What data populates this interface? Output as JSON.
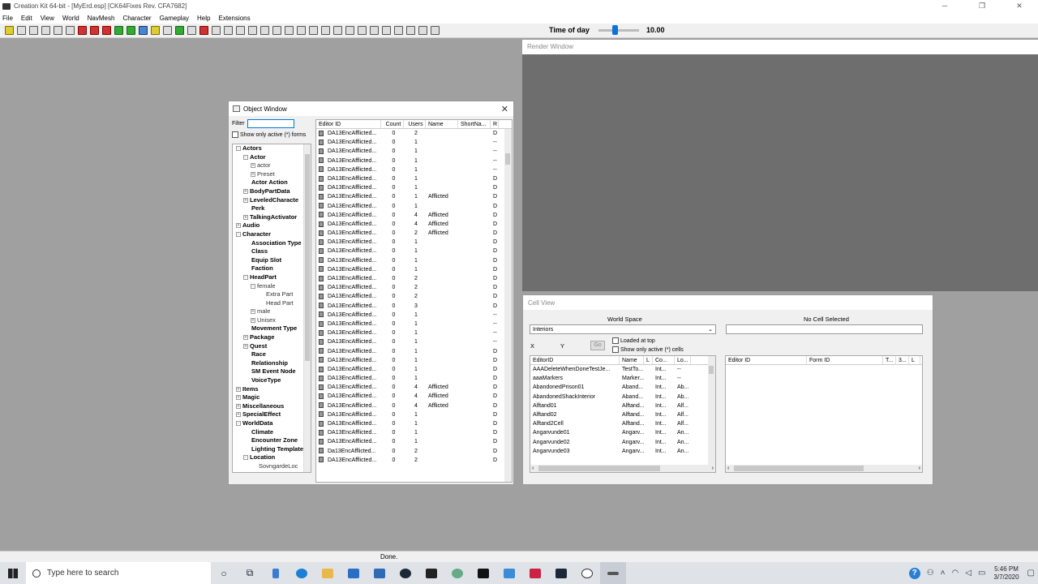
{
  "window": {
    "title": "Creation Kit 64-bit - [MyErd.esp] [CK64Fixes Rev. CFA7682]"
  },
  "menu": [
    "File",
    "Edit",
    "View",
    "World",
    "NavMesh",
    "Character",
    "Gameplay",
    "Help",
    "Extensions"
  ],
  "toolbar": {
    "time_label": "Time of day",
    "time_value": "10.00",
    "time_fraction": 0.4
  },
  "render_window": {
    "title": "Render Window"
  },
  "object_window": {
    "title": "Object Window",
    "filter_label": "Filter",
    "filter_value": "",
    "show_active_label": "Show only active (*) forms",
    "tree": [
      {
        "label": "Actors",
        "level": 0,
        "exp": "-"
      },
      {
        "label": "Actor",
        "level": 1,
        "exp": "-"
      },
      {
        "label": "actor",
        "level": 2,
        "exp": "+",
        "light": true
      },
      {
        "label": "Preset",
        "level": 2,
        "exp": "+",
        "light": true
      },
      {
        "label": "Actor Action",
        "level": 1,
        "exp": ""
      },
      {
        "label": "BodyPartData",
        "level": 1,
        "exp": "+"
      },
      {
        "label": "LeveledCharacte",
        "level": 1,
        "exp": "+"
      },
      {
        "label": "Perk",
        "level": 1,
        "exp": ""
      },
      {
        "label": "TalkingActivator",
        "level": 1,
        "exp": "+"
      },
      {
        "label": "Audio",
        "level": 0,
        "exp": "+"
      },
      {
        "label": "Character",
        "level": 0,
        "exp": "-"
      },
      {
        "label": "Association Type",
        "level": 1,
        "exp": ""
      },
      {
        "label": "Class",
        "level": 1,
        "exp": ""
      },
      {
        "label": "Equip Slot",
        "level": 1,
        "exp": ""
      },
      {
        "label": "Faction",
        "level": 1,
        "exp": ""
      },
      {
        "label": "HeadPart",
        "level": 1,
        "exp": "-"
      },
      {
        "label": "female",
        "level": 2,
        "exp": "-",
        "light": true
      },
      {
        "label": "Extra Part",
        "level": 3,
        "exp": "",
        "light": true
      },
      {
        "label": "Head Part",
        "level": 3,
        "exp": "",
        "light": true
      },
      {
        "label": "male",
        "level": 2,
        "exp": "+",
        "light": true
      },
      {
        "label": "Unisex",
        "level": 2,
        "exp": "+",
        "light": true
      },
      {
        "label": "Movement Type",
        "level": 1,
        "exp": ""
      },
      {
        "label": "Package",
        "level": 1,
        "exp": "+"
      },
      {
        "label": "Quest",
        "level": 1,
        "exp": "+"
      },
      {
        "label": "Race",
        "level": 1,
        "exp": ""
      },
      {
        "label": "Relationship",
        "level": 1,
        "exp": ""
      },
      {
        "label": "SM Event Node",
        "level": 1,
        "exp": ""
      },
      {
        "label": "VoiceType",
        "level": 1,
        "exp": ""
      },
      {
        "label": "Items",
        "level": 0,
        "exp": "+"
      },
      {
        "label": "Magic",
        "level": 0,
        "exp": "+"
      },
      {
        "label": "Miscellaneous",
        "level": 0,
        "exp": "+"
      },
      {
        "label": "SpecialEffect",
        "level": 0,
        "exp": "+"
      },
      {
        "label": "WorldData",
        "level": 0,
        "exp": "-"
      },
      {
        "label": "Climate",
        "level": 1,
        "exp": ""
      },
      {
        "label": "Encounter Zone",
        "level": 1,
        "exp": ""
      },
      {
        "label": "Lighting Template",
        "level": 1,
        "exp": ""
      },
      {
        "label": "Location",
        "level": 1,
        "exp": "-"
      },
      {
        "label": "SovngardeLoc",
        "level": 2,
        "exp": "",
        "light": true
      }
    ],
    "columns": [
      "Editor ID",
      "Count",
      "Users",
      "Name",
      "ShortNa...",
      "R"
    ],
    "rows": [
      {
        "id": "DA13EncAfflicted...",
        "count": "0",
        "users": "2",
        "name": "",
        "r": "D"
      },
      {
        "id": "DA13EncAfflicted...",
        "count": "0",
        "users": "1",
        "name": "",
        "r": "--"
      },
      {
        "id": "DA13EncAfflicted...",
        "count": "0",
        "users": "1",
        "name": "",
        "r": "--"
      },
      {
        "id": "DA13EncAfflicted...",
        "count": "0",
        "users": "1",
        "name": "",
        "r": "--"
      },
      {
        "id": "DA13EncAfflicted...",
        "count": "0",
        "users": "1",
        "name": "",
        "r": "--"
      },
      {
        "id": "DA13EncAfflicted...",
        "count": "0",
        "users": "1",
        "name": "",
        "r": "D"
      },
      {
        "id": "DA13EncAfflicted...",
        "count": "0",
        "users": "1",
        "name": "",
        "r": "D"
      },
      {
        "id": "DA13EncAfflicted...",
        "count": "0",
        "users": "1",
        "name": "Afflicted",
        "r": "D"
      },
      {
        "id": "DA13EncAfflicted...",
        "count": "0",
        "users": "1",
        "name": "",
        "r": "D"
      },
      {
        "id": "DA13EncAfflicted...",
        "count": "0",
        "users": "4",
        "name": "Afflicted",
        "r": "D"
      },
      {
        "id": "DA13EncAfflicted...",
        "count": "0",
        "users": "4",
        "name": "Afflicted",
        "r": "D"
      },
      {
        "id": "DA13EncAfflicted...",
        "count": "0",
        "users": "2",
        "name": "Afflicted",
        "r": "D"
      },
      {
        "id": "DA13EncAfflicted...",
        "count": "0",
        "users": "1",
        "name": "",
        "r": "D"
      },
      {
        "id": "DA13EncAfflicted...",
        "count": "0",
        "users": "1",
        "name": "",
        "r": "D"
      },
      {
        "id": "DA13EncAfflicted...",
        "count": "0",
        "users": "1",
        "name": "",
        "r": "D"
      },
      {
        "id": "DA13EncAfflicted...",
        "count": "0",
        "users": "1",
        "name": "",
        "r": "D"
      },
      {
        "id": "DA13EncAfflicted...",
        "count": "0",
        "users": "2",
        "name": "",
        "r": "D"
      },
      {
        "id": "DA13EncAfflicted...",
        "count": "0",
        "users": "2",
        "name": "",
        "r": "D"
      },
      {
        "id": "DA13EncAfflicted...",
        "count": "0",
        "users": "2",
        "name": "",
        "r": "D"
      },
      {
        "id": "DA13EncAfflicted...",
        "count": "0",
        "users": "3",
        "name": "",
        "r": "D"
      },
      {
        "id": "DA13EncAfflicted...",
        "count": "0",
        "users": "1",
        "name": "",
        "r": "--"
      },
      {
        "id": "DA13EncAfflicted...",
        "count": "0",
        "users": "1",
        "name": "",
        "r": "--"
      },
      {
        "id": "DA13EncAfflicted...",
        "count": "0",
        "users": "1",
        "name": "",
        "r": "--"
      },
      {
        "id": "DA13EncAfflicted...",
        "count": "0",
        "users": "1",
        "name": "",
        "r": "--"
      },
      {
        "id": "DA13EncAfflicted...",
        "count": "0",
        "users": "1",
        "name": "",
        "r": "D"
      },
      {
        "id": "DA13EncAfflicted...",
        "count": "0",
        "users": "1",
        "name": "",
        "r": "D"
      },
      {
        "id": "DA13EncAfflicted...",
        "count": "0",
        "users": "1",
        "name": "",
        "r": "D"
      },
      {
        "id": "DA13EncAfflicted...",
        "count": "0",
        "users": "1",
        "name": "",
        "r": "D"
      },
      {
        "id": "DA13EncAfflicted...",
        "count": "0",
        "users": "4",
        "name": "Afflicted",
        "r": "D"
      },
      {
        "id": "DA13EncAfflicted...",
        "count": "0",
        "users": "4",
        "name": "Afflicted",
        "r": "D"
      },
      {
        "id": "DA13EncAfflicted...",
        "count": "0",
        "users": "4",
        "name": "Afflicted",
        "r": "D"
      },
      {
        "id": "DA13EncAfflicted...",
        "count": "0",
        "users": "1",
        "name": "",
        "r": "D"
      },
      {
        "id": "DA13EncAfflicted...",
        "count": "0",
        "users": "1",
        "name": "",
        "r": "D"
      },
      {
        "id": "DA13EncAfflicted...",
        "count": "0",
        "users": "1",
        "name": "",
        "r": "D"
      },
      {
        "id": "DA13EncAfflicted...",
        "count": "0",
        "users": "1",
        "name": "",
        "r": "D"
      },
      {
        "id": "Da13EncAfflicted...",
        "count": "0",
        "users": "2",
        "name": "",
        "r": "D"
      },
      {
        "id": "DA13EncAfflicted...",
        "count": "0",
        "users": "2",
        "name": "",
        "r": "D"
      }
    ]
  },
  "cell_view": {
    "title": "Cell View",
    "world_space_label": "World Space",
    "world_space_value": "Interiors",
    "no_cell_label": "No Cell Selected",
    "x_label": "X",
    "y_label": "Y",
    "go_label": "Go",
    "loaded_at_top_label": "Loaded at top",
    "show_active_label": "Show only active (*) cells",
    "cell_columns": [
      "EditorID",
      "Name",
      "L",
      "Co...",
      "Lo..."
    ],
    "cells": [
      {
        "id": "AAADeleteWhenDoneTestJe...",
        "name": "TestTo...",
        "co": "Int...",
        "lo": "--"
      },
      {
        "id": "aaaMarkers",
        "name": "Marker...",
        "co": "Int...",
        "lo": "--"
      },
      {
        "id": "AbandonedPrison01",
        "name": "Aband...",
        "co": "Int...",
        "lo": "Ab..."
      },
      {
        "id": "AbandonedShackInterior",
        "name": "Aband...",
        "co": "Int...",
        "lo": "Ab..."
      },
      {
        "id": "Alftand01",
        "name": "Alftand...",
        "co": "Int...",
        "lo": "Alf..."
      },
      {
        "id": "Alftand02",
        "name": "Alftand...",
        "co": "Int...",
        "lo": "Alf..."
      },
      {
        "id": "Alftand2Cell",
        "name": "Alftand...",
        "co": "Int...",
        "lo": "Alf..."
      },
      {
        "id": "Angarvunde01",
        "name": "Angarv...",
        "co": "Int...",
        "lo": "An..."
      },
      {
        "id": "Angarvunde02",
        "name": "Angarv...",
        "co": "Int...",
        "lo": "An..."
      },
      {
        "id": "Angarvunde03",
        "name": "Angarv...",
        "co": "Int...",
        "lo": "An..."
      }
    ],
    "ref_columns": [
      "Editor ID",
      "Form ID",
      "T...",
      "3...",
      "L"
    ]
  },
  "status": {
    "text": "Done."
  },
  "taskbar": {
    "search_placeholder": "Type here to search",
    "time": "5:46 PM",
    "date": "3/7/2020"
  }
}
